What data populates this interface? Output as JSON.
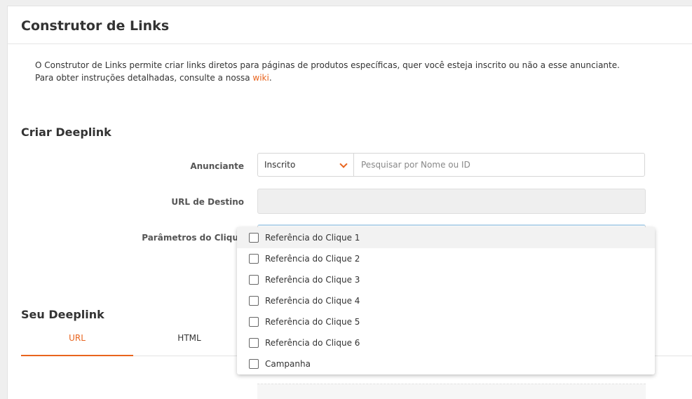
{
  "page": {
    "title": "Construtor de Links",
    "intro_line1": "O Construtor de Links permite criar links diretos para páginas de produtos específicas, quer você esteja inscrito ou não a esse anunciante.",
    "intro_line2_prefix": "Para obter instruções detalhadas, consulte a nossa ",
    "intro_link": "wiki",
    "intro_line2_suffix": "."
  },
  "create": {
    "section_title": "Criar Deeplink",
    "advertiser_label": "Anunciante",
    "advertiser_select_value": "Inscrito",
    "advertiser_search_placeholder": "Pesquisar por Nome ou ID",
    "destination_label": "URL de Destino",
    "destination_value": "",
    "params_label": "Parâmetros do Clique"
  },
  "params_dropdown": {
    "options": [
      "Referência do Clique 1",
      "Referência do Clique 2",
      "Referência do Clique 3",
      "Referência do Clique 4",
      "Referência do Clique 5",
      "Referência do Clique 6",
      "Campanha"
    ]
  },
  "result": {
    "section_title": "Seu Deeplink",
    "tabs": [
      {
        "label": "URL",
        "active": true
      },
      {
        "label": "HTML",
        "active": false
      }
    ]
  },
  "colors": {
    "accent": "#e8641e",
    "background": "#efefef",
    "panel": "#ffffff"
  }
}
